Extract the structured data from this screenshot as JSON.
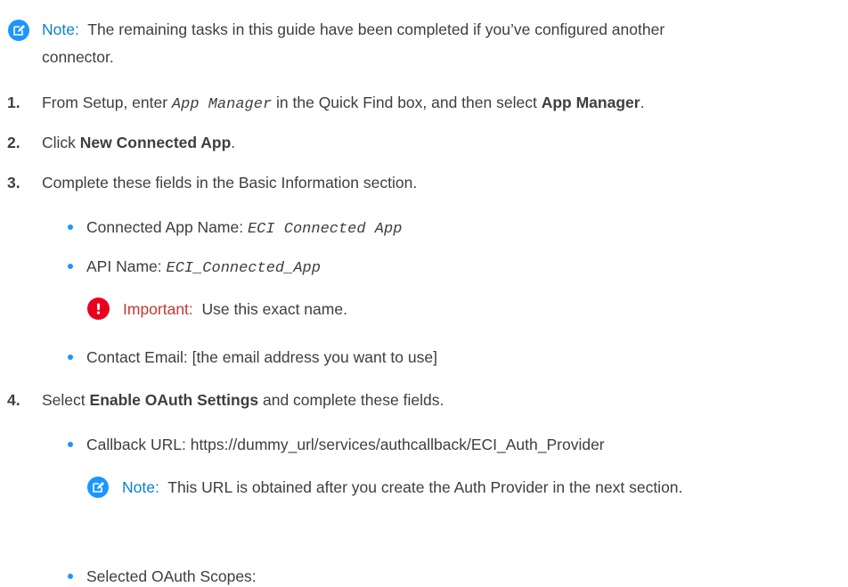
{
  "note1": {
    "label": "Note:",
    "text": "The remaining tasks in this guide have been completed if you’ve configured another",
    "text_line2": "connector."
  },
  "steps": [
    {
      "number": "1.",
      "pre": "From Setup, enter",
      "code": "App Manager",
      "mid": "in the Quick Find box, and then select",
      "bold": "App Manager",
      "post": "."
    },
    {
      "number": "2.",
      "pre": "Click",
      "bold": "New Connected App",
      "post": "."
    },
    {
      "number": "3.",
      "text": "Complete these fields in the Basic Information section.",
      "bullets": [
        {
          "label": "Connected App Name:",
          "code": "ECI Connected App"
        },
        {
          "label": "API Name:",
          "code": "ECI_Connected_App"
        },
        {
          "label": "Contact Email: [the email address you want to use]"
        }
      ],
      "important": {
        "label": "Important:",
        "text": "Use this exact name."
      }
    },
    {
      "number": "4.",
      "pre": "Select",
      "bold": "Enable OAuth Settings",
      "post": "and complete these fields.",
      "bullets": [
        {
          "label": "Callback URL: https://dummy_url/services/authcallback/ECI_Auth_Provider"
        },
        {
          "label": "Selected OAuth Scopes:"
        }
      ],
      "note": {
        "label": "Note:",
        "text": "This URL is obtained after you create the Auth Provider in the next section."
      }
    }
  ],
  "colors": {
    "note_accent": "#1b96ff",
    "important_accent": "#ea001e",
    "text": "#3e3e3c"
  }
}
